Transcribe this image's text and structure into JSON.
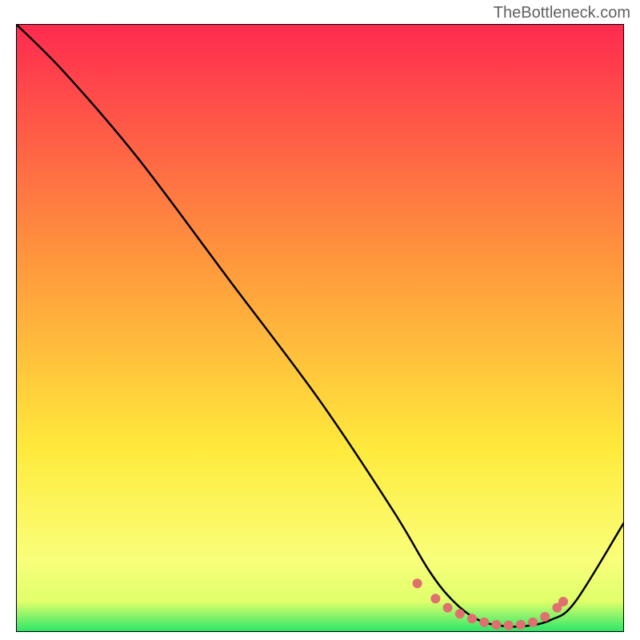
{
  "watermark": "TheBottleneck.com",
  "chart_data": {
    "type": "line",
    "title": "",
    "xlabel": "",
    "ylabel": "",
    "xlim": [
      0,
      100
    ],
    "ylim": [
      0,
      100
    ],
    "curve": {
      "x": [
        0,
        8,
        20,
        35,
        50,
        62,
        68,
        72,
        76,
        80,
        84,
        88,
        92,
        100
      ],
      "y": [
        100,
        92,
        78,
        58,
        38,
        20,
        10,
        5,
        2,
        1,
        1,
        2,
        5,
        18
      ]
    },
    "markers": {
      "x": [
        66,
        69,
        71,
        73,
        75,
        77,
        79,
        81,
        83,
        85,
        87,
        89,
        90
      ],
      "y": [
        8,
        5.5,
        4,
        3,
        2.2,
        1.6,
        1.2,
        1.1,
        1.2,
        1.6,
        2.5,
        4,
        5
      ],
      "color": "#E06F6F"
    },
    "background_gradient": {
      "stops": [
        {
          "offset": 0,
          "color": "#FF2A4F"
        },
        {
          "offset": 40,
          "color": "#FF9A3C"
        },
        {
          "offset": 70,
          "color": "#FFEA3C"
        },
        {
          "offset": 88,
          "color": "#F9FF7A"
        },
        {
          "offset": 95,
          "color": "#DFFF6A"
        },
        {
          "offset": 100,
          "color": "#28E66A"
        }
      ]
    }
  }
}
